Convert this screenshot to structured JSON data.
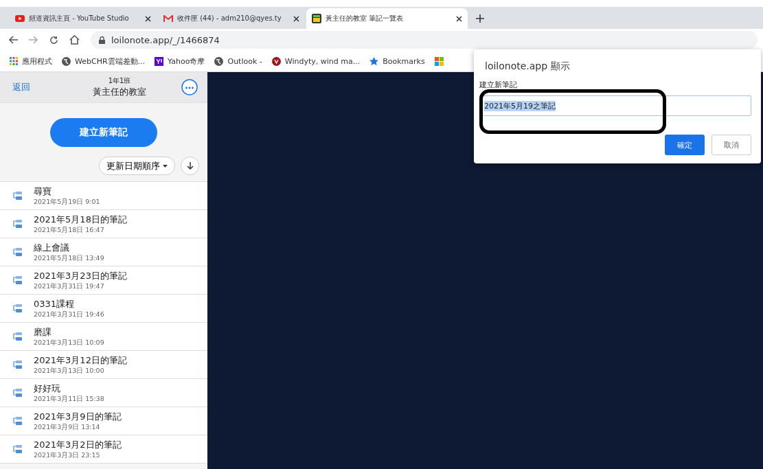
{
  "browser": {
    "tabs": [
      {
        "title": "頻道資訊主頁 - YouTube Studio",
        "selected": false
      },
      {
        "title": "收件匣 (44) - adm210@qyes.ty",
        "selected": false
      },
      {
        "title": "黃主任的教室 筆記一覽表",
        "selected": true
      }
    ],
    "address": "loilonote.app/_/1466874",
    "bookmarks": [
      {
        "label": "應用程式"
      },
      {
        "label": "WebCHR雲端差動..."
      },
      {
        "label": "Yahoo奇摩"
      },
      {
        "label": "Outlook -"
      },
      {
        "label": "Windyty, wind ma..."
      },
      {
        "label": "Bookmarks"
      }
    ]
  },
  "sidebar": {
    "back": "返回",
    "class": "1年1班",
    "title": "黃主任的教室",
    "new_note": "建立新筆記",
    "sort": "更新日期順序",
    "notes": [
      {
        "title": "尋寶",
        "date": "2021年5月19日 9:01"
      },
      {
        "title": "2021年5月18日的筆記",
        "date": "2021年5月18日 16:47"
      },
      {
        "title": "線上會議",
        "date": "2021年5月18日 13:49"
      },
      {
        "title": "2021年3月23日的筆記",
        "date": "2021年3月31日 19:47"
      },
      {
        "title": "0331課程",
        "date": "2021年3月31日 19:46"
      },
      {
        "title": "磨課",
        "date": "2021年3月13日 10:09"
      },
      {
        "title": "2021年3月12日的筆記",
        "date": "2021年3月13日 10:00"
      },
      {
        "title": "好好玩",
        "date": "2021年3月11日 15:38"
      },
      {
        "title": "2021年3月9日的筆記",
        "date": "2021年3月9日 13:14"
      },
      {
        "title": "2021年3月2日的筆記",
        "date": "2021年3月3日 23:15"
      }
    ]
  },
  "dialog": {
    "title": "loilonote.app 顯示",
    "message": "建立新筆記",
    "value": "2021年5月19之筆記",
    "ok": "確定",
    "cancel": "取消"
  }
}
